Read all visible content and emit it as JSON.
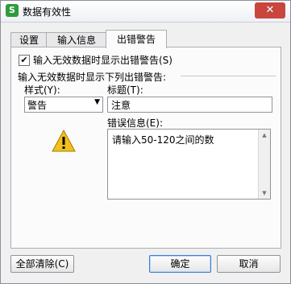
{
  "window": {
    "title": "数据有效性",
    "app_icon_letter": "S",
    "close_label": "✕"
  },
  "tabs": [
    {
      "label": "设置",
      "active": false
    },
    {
      "label": "输入信息",
      "active": false
    },
    {
      "label": "出错警告",
      "active": true
    }
  ],
  "error_alert": {
    "show_checkbox_label": "输入无效数据时显示出错警告(S)",
    "show_checked": true,
    "section_label": "输入无效数据时显示下列出错警告:",
    "style_label": "样式(Y):",
    "style_value": "警告",
    "title_label": "标题(T):",
    "title_value": "注意",
    "message_label": "错误信息(E):",
    "message_value": "请输入50-120之间的数"
  },
  "buttons": {
    "clear_all": "全部清除(C)",
    "ok": "确定",
    "cancel": "取消"
  },
  "icons": {
    "warning": "warning-triangle-icon",
    "dropdown": "chevron-down-icon"
  }
}
